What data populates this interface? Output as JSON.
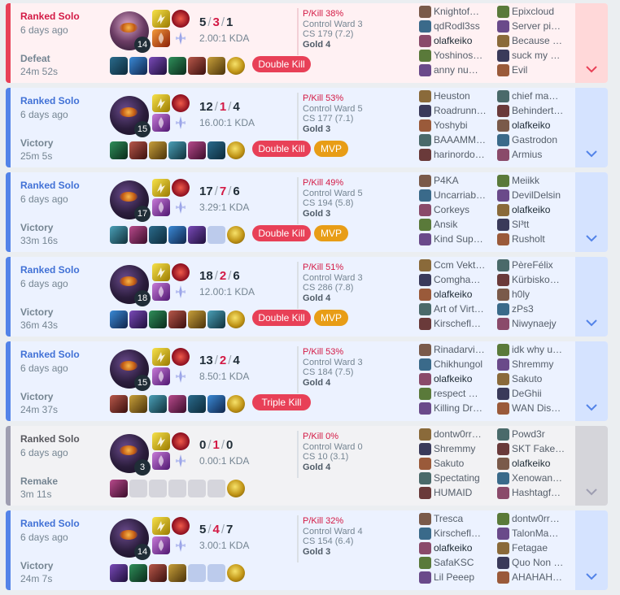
{
  "colors": {
    "win_accent": "#5383e8",
    "loss_accent": "#e84057",
    "remake_accent": "#9e9eb1",
    "mvp_badge": "#e89d16",
    "multikill_badge": "#e84057"
  },
  "matches": [
    {
      "result_type": "loss",
      "queue": "Ranked Solo",
      "ago": "6 days ago",
      "result": "Defeat",
      "duration": "24m 52s",
      "champion_level": "14",
      "kills": "5",
      "deaths": "3",
      "assists": "1",
      "kda_ratio": "2.00:1 KDA",
      "pkill": "P/Kill 38%",
      "control_ward": "Control Ward 3",
      "cs": "CS 179 (7.2)",
      "tier": "Gold 4",
      "items": [
        "item",
        "item",
        "item",
        "item",
        "item",
        "item",
        "trinket"
      ],
      "multikill": "Double Kill",
      "mvp": "",
      "blue_team": [
        "Knightof…",
        "qdRodl3ss",
        "olafkeiko",
        "Yoshinos…",
        "anny nu…"
      ],
      "red_team": [
        "Epixcloud",
        "Server pi…",
        "Because …",
        "suck my …",
        "Evil"
      ]
    },
    {
      "result_type": "win",
      "queue": "Ranked Solo",
      "ago": "6 days ago",
      "result": "Victory",
      "duration": "25m 5s",
      "champion_level": "15",
      "kills": "12",
      "deaths": "1",
      "assists": "4",
      "kda_ratio": "16.00:1 KDA",
      "pkill": "P/Kill 53%",
      "control_ward": "Control Ward 5",
      "cs": "CS 177 (7.1)",
      "tier": "Gold 3",
      "items": [
        "item",
        "item",
        "item",
        "item",
        "item",
        "item",
        "trinket"
      ],
      "multikill": "Double Kill",
      "mvp": "MVP",
      "blue_team": [
        "Heuston",
        "Roadrunn…",
        "Yoshybi",
        "BAAAMM…",
        "harinordo…"
      ],
      "red_team": [
        "chief ma…",
        "Behindert…",
        "olafkeiko",
        "Gastrodon",
        "Armius"
      ]
    },
    {
      "result_type": "win",
      "queue": "Ranked Solo",
      "ago": "6 days ago",
      "result": "Victory",
      "duration": "33m 16s",
      "champion_level": "17",
      "kills": "17",
      "deaths": "7",
      "assists": "6",
      "kda_ratio": "3.29:1 KDA",
      "pkill": "P/Kill 49%",
      "control_ward": "Control Ward 5",
      "cs": "CS 194 (5.8)",
      "tier": "Gold 3",
      "items": [
        "item",
        "item",
        "item",
        "item",
        "item",
        "empty",
        "trinket"
      ],
      "multikill": "Double Kill",
      "mvp": "MVP",
      "blue_team": [
        "P4KA",
        "Uncarriab…",
        "Corkeys",
        "Ansik",
        "Kind Sup…"
      ],
      "red_team": [
        "Meiikk",
        "DevilDelsin",
        "olafkeiko",
        "Sl³tt",
        "Rusholt"
      ]
    },
    {
      "result_type": "win",
      "queue": "Ranked Solo",
      "ago": "6 days ago",
      "result": "Victory",
      "duration": "36m 43s",
      "champion_level": "18",
      "kills": "18",
      "deaths": "2",
      "assists": "6",
      "kda_ratio": "12.00:1 KDA",
      "pkill": "P/Kill 51%",
      "control_ward": "Control Ward 3",
      "cs": "CS 286 (7.8)",
      "tier": "Gold 4",
      "items": [
        "item",
        "item",
        "item",
        "item",
        "item",
        "item",
        "trinket"
      ],
      "multikill": "Double Kill",
      "mvp": "MVP",
      "blue_team": [
        "Ccm Vekt…",
        "Comgha…",
        "olafkeiko",
        "Art of Virt…",
        "Kirschefl…"
      ],
      "red_team": [
        "PèreFélix",
        "Kürbisko…",
        "h0ly",
        "zPs3",
        "Niwynaejy"
      ]
    },
    {
      "result_type": "win",
      "queue": "Ranked Solo",
      "ago": "6 days ago",
      "result": "Victory",
      "duration": "24m 37s",
      "champion_level": "15",
      "kills": "13",
      "deaths": "2",
      "assists": "4",
      "kda_ratio": "8.50:1 KDA",
      "pkill": "P/Kill 53%",
      "control_ward": "Control Ward 3",
      "cs": "CS 184 (7.5)",
      "tier": "Gold 4",
      "items": [
        "item",
        "item",
        "item",
        "item",
        "item",
        "item",
        "trinket"
      ],
      "multikill": "Triple Kill",
      "mvp": "",
      "blue_team": [
        "Rinadarvi…",
        "Chikhungol",
        "olafkeiko",
        "respect …",
        "Killing Dr…"
      ],
      "red_team": [
        "idk why u…",
        "Shremmy",
        "Sakuto",
        "DeGhii",
        "WAN Dis…"
      ]
    },
    {
      "result_type": "remake",
      "queue": "Ranked Solo",
      "ago": "6 days ago",
      "result": "Remake",
      "duration": "3m 11s",
      "champion_level": "3",
      "kills": "0",
      "deaths": "1",
      "assists": "0",
      "kda_ratio": "0.00:1 KDA",
      "pkill": "P/Kill 0%",
      "control_ward": "Control Ward 0",
      "cs": "CS 10 (3.1)",
      "tier": "Gold 4",
      "items": [
        "item",
        "empty",
        "empty",
        "empty",
        "empty",
        "empty",
        "trinket"
      ],
      "multikill": "",
      "mvp": "",
      "blue_team": [
        "dontw0rr…",
        "Shremmy",
        "Sakuto",
        "Spectating",
        "HUMAID"
      ],
      "red_team": [
        "Powd3r",
        "SKT Fake…",
        "olafkeiko",
        "Xenowan…",
        "Hashtagf…"
      ]
    },
    {
      "result_type": "win",
      "queue": "Ranked Solo",
      "ago": "6 days ago",
      "result": "Victory",
      "duration": "24m 7s",
      "champion_level": "14",
      "kills": "5",
      "deaths": "4",
      "assists": "7",
      "kda_ratio": "3.00:1 KDA",
      "pkill": "P/Kill 32%",
      "control_ward": "Control Ward 4",
      "cs": "CS 154 (6.4)",
      "tier": "Gold 3",
      "items": [
        "item",
        "item",
        "item",
        "item",
        "empty",
        "empty",
        "trinket"
      ],
      "multikill": "",
      "mvp": "",
      "blue_team": [
        "Tresca",
        "Kirschefl…",
        "olafkeiko",
        "SafaKSC",
        "Lil Peeep"
      ],
      "red_team": [
        "dontw0rr…",
        "TalonMa…",
        "Fetagae",
        "Quo Non …",
        "AHAHAH…"
      ]
    }
  ]
}
